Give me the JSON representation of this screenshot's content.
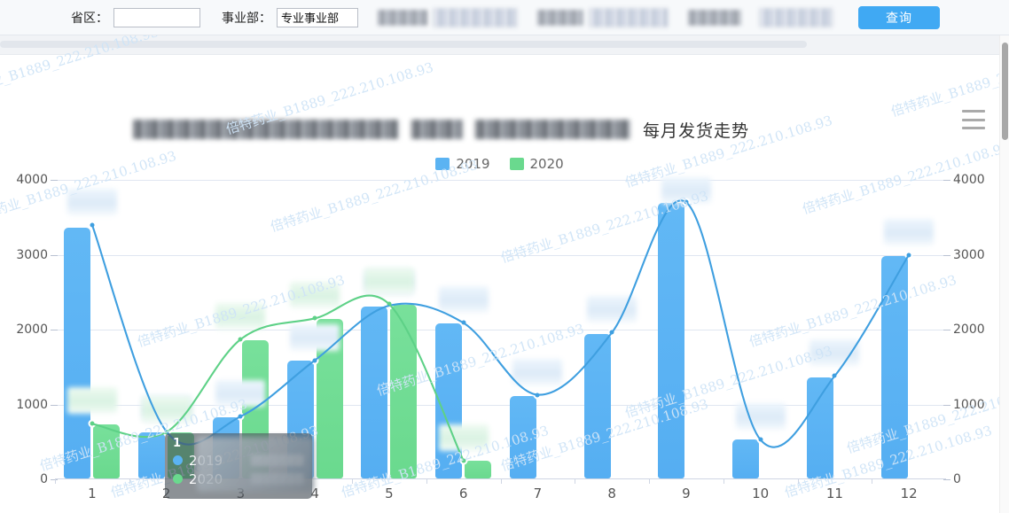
{
  "toolbar": {
    "province_label": "省区：",
    "province_value": "",
    "province_placeholder": "",
    "division_label": "事业部：",
    "division_value": "专业事业部",
    "query_label": "查询",
    "redacted_fields": [
      {
        "label_w": 58,
        "input_w": 96,
        "input": true
      },
      {
        "label_w": 52,
        "input_w": 92,
        "input": true
      },
      {
        "label_w": 62,
        "input_w": 0,
        "input": false
      },
      {
        "label_w": 64,
        "input_w": 82,
        "input": true
      }
    ]
  },
  "chart": {
    "title_redacted_w": [
      300,
      60,
      175
    ],
    "title_visible": "每月发货走势",
    "toolbox_icon": "hamburger-menu-icon",
    "legend_position": "top-center"
  },
  "chart_data": {
    "type": "bar",
    "title": "每月发货走势",
    "xlabel": "",
    "ylabel": "",
    "grid": true,
    "categories": [
      "1",
      "2",
      "3",
      "4",
      "5",
      "6",
      "7",
      "8",
      "9",
      "10",
      "11",
      "12"
    ],
    "ylim": [
      0,
      4000
    ],
    "yticks": [
      0,
      1000,
      2000,
      3000,
      4000
    ],
    "y_axis_right": true,
    "yticks_right": [
      0,
      1000,
      2000,
      3000,
      4000
    ],
    "series": [
      {
        "name": "2019",
        "type": "bar",
        "color": "#5bb3f2",
        "values": [
          3350,
          620,
          820,
          1570,
          2300,
          2070,
          1100,
          1930,
          3680,
          520,
          1350,
          2970
        ]
      },
      {
        "name": "2020",
        "type": "bar",
        "color": "#6ad98e",
        "values": [
          720,
          610,
          1850,
          2130,
          2320,
          240,
          null,
          null,
          null,
          null,
          null,
          null
        ]
      },
      {
        "name": "2019",
        "type": "line",
        "color": "#3f9fe0",
        "values": [
          3400,
          640,
          840,
          1590,
          2320,
          2090,
          1130,
          1960,
          3700,
          530,
          1380,
          3000
        ]
      },
      {
        "name": "2020",
        "type": "line",
        "color": "#5ed187",
        "values": [
          740,
          630,
          1870,
          2150,
          2340,
          250,
          null,
          null,
          null,
          null,
          null,
          null
        ]
      }
    ],
    "legend": [
      "2019",
      "2020"
    ]
  },
  "tooltip": {
    "visible": true,
    "title": "1",
    "rows": [
      {
        "name": "2019",
        "color": "#5bb3f2",
        "value_redacted": true
      },
      {
        "name": "2020",
        "color": "#6ad98e",
        "value_redacted": true
      }
    ]
  },
  "watermark": {
    "text": "倍特药业_B1889_222.210.108.93",
    "color": "#cfe4f7"
  },
  "scrollbar": {
    "orientation": "vertical"
  }
}
